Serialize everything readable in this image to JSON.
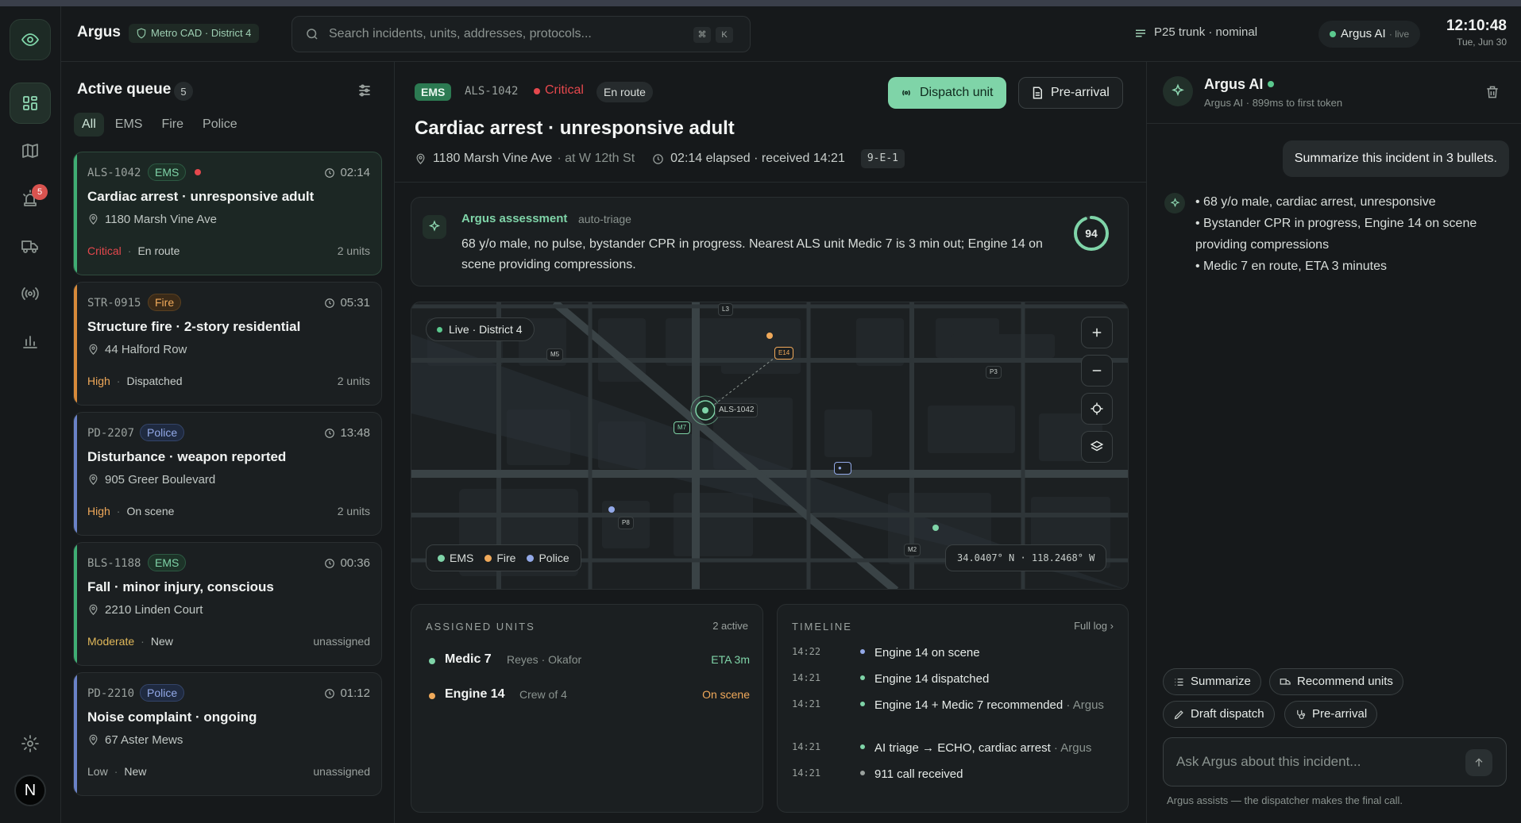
{
  "app": {
    "title": "Argus",
    "district": "Metro CAD · District 4"
  },
  "colors": {
    "accent": "#7fd4a8",
    "critical": "#e5484d",
    "fire": "#f0a95a",
    "police": "#93a9e8",
    "background": "#16191b"
  },
  "rail": {
    "items": [
      {
        "name": "logo",
        "icon": "eye-icon"
      },
      {
        "name": "dashboard",
        "icon": "grid-icon",
        "active": true
      },
      {
        "name": "map",
        "icon": "map-icon"
      },
      {
        "name": "alerts",
        "icon": "siren-icon",
        "badge": "5"
      },
      {
        "name": "units",
        "icon": "truck-icon"
      },
      {
        "name": "radio",
        "icon": "radio-icon"
      },
      {
        "name": "reports",
        "icon": "bar-chart-icon"
      }
    ],
    "settings_icon": "gear-icon",
    "avatar": "N"
  },
  "header": {
    "search_placeholder": "Search incidents, units, addresses, protocols...",
    "kbd_1": "⌘",
    "kbd_2": "K",
    "trunk": "P25 trunk · nominal",
    "ai_label": "Argus AI",
    "ai_live": "· live",
    "time": "12:10:48",
    "date": "Tue, Jun 30"
  },
  "queue": {
    "title": "Active queue",
    "count": "5",
    "filters": [
      "All",
      "EMS",
      "Fire",
      "Police"
    ],
    "cards": [
      {
        "id": "ALS-1042",
        "type": "EMS",
        "time": "02:14",
        "title": "Cardiac arrest · unresponsive adult",
        "address": "1180 Marsh Vine Ave",
        "severity": "Critical",
        "status": "En route",
        "units": "2 units"
      },
      {
        "id": "STR-0915",
        "type": "Fire",
        "time": "05:31",
        "title": "Structure fire · 2-story residential",
        "address": "44 Halford Row",
        "severity": "High",
        "status": "Dispatched",
        "units": "2 units"
      },
      {
        "id": "PD-2207",
        "type": "Police",
        "time": "13:48",
        "title": "Disturbance · weapon reported",
        "address": "905 Greer Boulevard",
        "severity": "High",
        "status": "On scene",
        "units": "2 units"
      },
      {
        "id": "BLS-1188",
        "type": "EMS",
        "time": "00:36",
        "title": "Fall · minor injury, conscious",
        "address": "2210 Linden Court",
        "severity": "Moderate",
        "status": "New",
        "units": "unassigned"
      },
      {
        "id": "PD-2210",
        "type": "Police",
        "time": "01:12",
        "title": "Noise complaint · ongoing",
        "address": "67 Aster Mews",
        "severity": "Low",
        "status": "New",
        "units": "unassigned"
      }
    ]
  },
  "incident": {
    "type": "EMS",
    "id": "ALS-1042",
    "severity": "Critical",
    "status": "En route",
    "dispatch_label": "Dispatch unit",
    "prearrival_label": "Pre-arrival",
    "title": "Cardiac arrest · unresponsive adult",
    "address": "1180 Marsh Vine Ave",
    "cross": "· at W 12th St",
    "elapsed": "02:14 elapsed · received 14:21",
    "code": "9-E-1"
  },
  "assessment": {
    "title": "Argus assessment",
    "subtitle": "auto-triage",
    "text": "68 y/o male, no pulse, bystander CPR in progress. Nearest ALS unit Medic 7 is 3 min out; Engine 14 on scene providing compressions.",
    "score": "94",
    "score_fraction": 0.94
  },
  "map": {
    "live_label": "Live · District 4",
    "incident_label": "ALS-1042",
    "unit_labels": [
      "L3",
      "M5",
      "E14",
      "P3",
      "M7",
      "P8",
      "M2"
    ],
    "legend": [
      "EMS",
      "Fire",
      "Police"
    ],
    "coords": "34.0407° N · 118.2468° W"
  },
  "assigned": {
    "title": "ASSIGNED UNITS",
    "active": "2 active",
    "units": [
      {
        "name": "Medic 7",
        "crew": "Reyes · Okafor",
        "status": "ETA 3m",
        "color": "#7fd4a8"
      },
      {
        "name": "Engine 14",
        "crew": "Crew of 4",
        "status": "On scene",
        "color": "#f0a95a"
      }
    ]
  },
  "timeline": {
    "title": "TIMELINE",
    "full_log": "Full log",
    "events": [
      {
        "time": "14:22",
        "text": "Engine 14 on scene",
        "by": "",
        "color": "#93a9e8"
      },
      {
        "time": "14:21",
        "text": "Engine 14 dispatched",
        "by": "",
        "color": "#7fd4a8"
      },
      {
        "time": "14:21",
        "text": "Engine 14 + Medic 7 recommended",
        "by": "· Argus",
        "color": "#7fd4a8"
      },
      {
        "time": "14:21",
        "text": "AI triage → ECHO, cardiac arrest",
        "by": "· Argus",
        "color": "#7fd4a8"
      },
      {
        "time": "14:21",
        "text": "911 call received",
        "by": "",
        "color": "#9aa19e"
      }
    ]
  },
  "ai": {
    "name": "Argus AI",
    "subtitle": "Argus AI · 899ms to first token",
    "user_message": "Summarize this incident in 3 bullets.",
    "response": [
      "• 68 y/o male, cardiac arrest, unresponsive",
      "• Bystander CPR in progress, Engine 14 on scene providing compressions",
      "• Medic 7 en route, ETA 3 minutes"
    ],
    "chips": [
      "Summarize",
      "Recommend units",
      "Draft dispatch",
      "Pre-arrival"
    ],
    "input_placeholder": "Ask Argus about this incident...",
    "footer": "Argus assists — the dispatcher makes the final call."
  }
}
